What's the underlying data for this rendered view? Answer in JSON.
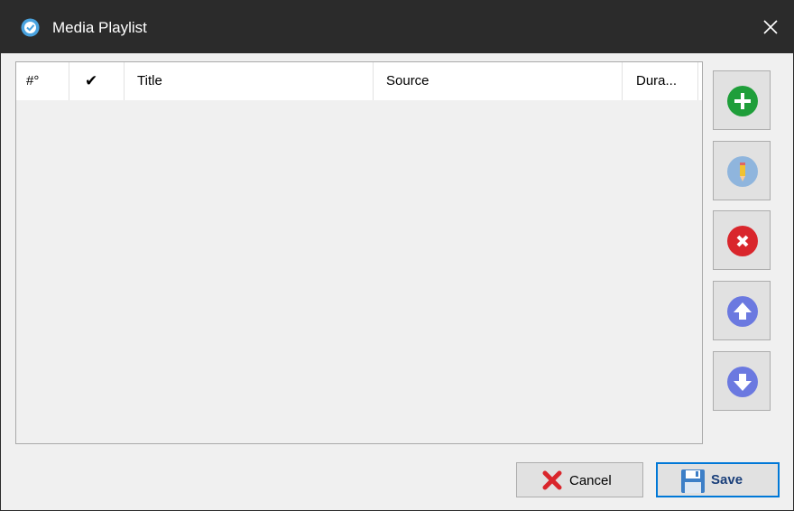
{
  "window": {
    "title": "Media Playlist",
    "app_icon": "app-logo-icon",
    "close_icon": "close-icon"
  },
  "grid": {
    "columns": [
      "#°",
      "✔",
      "Title",
      "Source",
      "Dura..."
    ],
    "rows": []
  },
  "side_toolbar": {
    "buttons": [
      {
        "name": "add-button",
        "icon": "plus-circle-icon",
        "color": "#1f9e3a"
      },
      {
        "name": "edit-button",
        "icon": "pencil-icon",
        "color": "#8fb5dd"
      },
      {
        "name": "delete-button",
        "icon": "x-circle-icon",
        "color": "#d9262c"
      },
      {
        "name": "move-up-button",
        "icon": "arrow-up-circle-icon",
        "color": "#6b79e0"
      },
      {
        "name": "move-down-button",
        "icon": "arrow-down-circle-icon",
        "color": "#6b79e0"
      }
    ]
  },
  "footer": {
    "cancel_label": "Cancel",
    "save_label": "Save",
    "cancel_icon": "red-x-icon",
    "save_icon": "floppy-disk-icon"
  },
  "colors": {
    "titlebar": "#2b2b2b",
    "accent": "#0078d7",
    "window_bg": "#f0f0f0"
  }
}
